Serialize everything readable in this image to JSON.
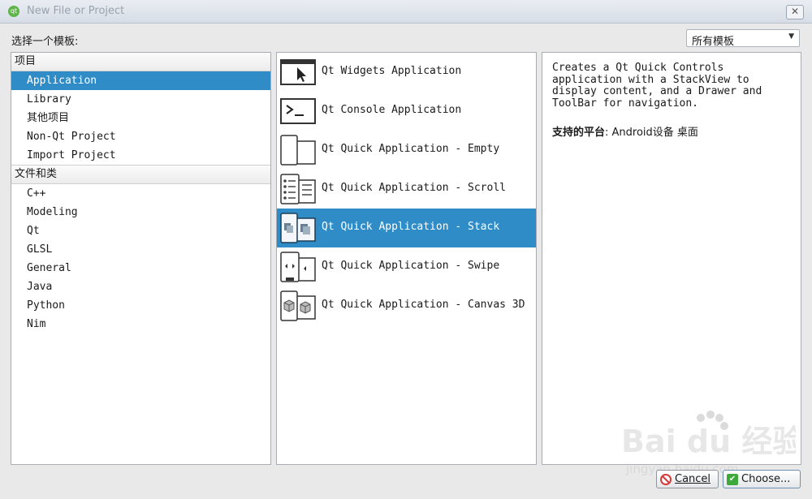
{
  "window": {
    "title": "New File or Project",
    "close_glyph": "✕",
    "app_icon": "qt-logo-icon"
  },
  "header": {
    "choose_label": "选择一个模板:",
    "filter": {
      "selected": "所有模板"
    }
  },
  "categories": {
    "projects_header": "项目",
    "projects": [
      "Application",
      "Library",
      "其他项目",
      "Non-Qt Project",
      "Import Project"
    ],
    "files_header": "文件和类",
    "files": [
      "C++",
      "Modeling",
      "Qt",
      "GLSL",
      "General",
      "Java",
      "Python",
      "Nim"
    ]
  },
  "templates": [
    {
      "label": "Qt Widgets Application",
      "icon": "widgets-window-cursor-icon"
    },
    {
      "label": "Qt Console Application",
      "icon": "console-prompt-icon"
    },
    {
      "label": "Qt Quick Application - Empty",
      "icon": "quick-empty-phone-icon"
    },
    {
      "label": "Qt Quick Application - Scroll",
      "icon": "quick-scroll-list-icon"
    },
    {
      "label": "Qt Quick Application - Stack",
      "icon": "quick-stack-cards-icon",
      "selected": true
    },
    {
      "label": "Qt Quick Application - Swipe",
      "icon": "quick-swipe-arrows-icon"
    },
    {
      "label": "Qt Quick Application - Canvas 3D",
      "icon": "quick-canvas-cube-icon"
    }
  ],
  "description": {
    "text": "Creates a Qt Quick Controls\napplication with a StackView to\ndisplay content, and a Drawer and\nToolBar for navigation.",
    "platforms_label": "支持的平台",
    "platforms_sep": ": ",
    "platforms": "Android设备 桌面"
  },
  "buttons": {
    "cancel": "Cancel",
    "choose": "Choose..."
  },
  "watermark": {
    "text": "Bai du 经验",
    "sub": "jingyan.baidu.com"
  },
  "colors": {
    "selection": "#308cc6",
    "cancel_icon": "#d43b3b",
    "choose_icon": "#3ea83a"
  }
}
